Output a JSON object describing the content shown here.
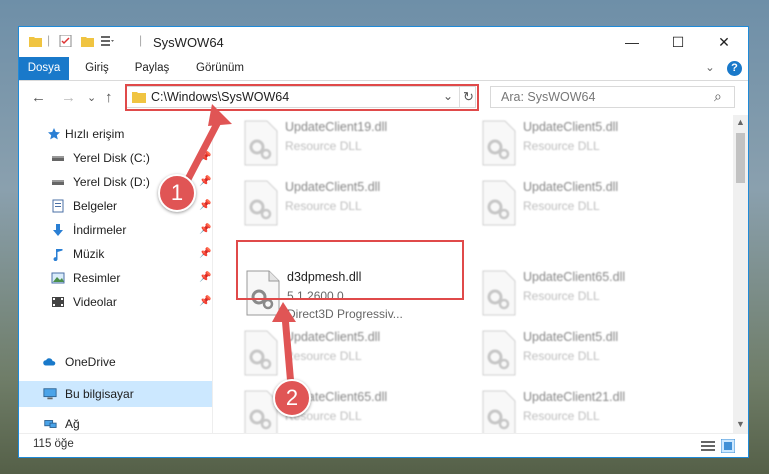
{
  "window": {
    "title": "SysWOW64",
    "minimize": "—",
    "maximize": "☐",
    "close": "✕"
  },
  "ribbon": {
    "tabs": [
      "Dosya",
      "Giriş",
      "Paylaş",
      "Görünüm"
    ],
    "collapse": "⌄",
    "help": "?"
  },
  "nav": {
    "back": "←",
    "forward": "→",
    "recent": "⌄",
    "up": "↑",
    "address": "C:\\Windows\\SysWOW64",
    "address_dropdown": "⌄",
    "refresh": "↻",
    "search_placeholder": "Ara: SysWOW64",
    "search_icon": "⌕"
  },
  "sidebar": {
    "items": [
      {
        "label": "Hızlı erişim",
        "icon": "star-icon"
      },
      {
        "label": "Yerel Disk (C:)",
        "icon": "drive-icon"
      },
      {
        "label": "Yerel Disk (D:)",
        "icon": "drive-icon"
      },
      {
        "label": "Belgeler",
        "icon": "documents-icon"
      },
      {
        "label": "İndirmeler",
        "icon": "download-icon"
      },
      {
        "label": "Müzik",
        "icon": "music-icon"
      },
      {
        "label": "Resimler",
        "icon": "pictures-icon"
      },
      {
        "label": "Videolar",
        "icon": "videos-icon"
      },
      {
        "label": "OneDrive",
        "icon": "cloud-icon"
      },
      {
        "label": "Bu bilgisayar",
        "icon": "computer-icon"
      },
      {
        "label": "Ağ",
        "icon": "network-icon"
      }
    ],
    "pin": "📌"
  },
  "files": [
    {
      "name": "UpdateClient19.dll",
      "type": "Resource DLL"
    },
    {
      "name": "UpdateClient5.dll",
      "type": "Resource DLL"
    },
    {
      "name": "UpdateClient5.dll",
      "type": "Resource DLL"
    },
    {
      "name": "UpdateClient5.dll",
      "type": "Resource DLL"
    },
    {
      "name": "d3dpmesh.dll",
      "version": "5.1.2600.0",
      "type": "Direct3D Progressiv..."
    },
    {
      "name": "UpdateClient65.dll",
      "type": "Resource DLL"
    },
    {
      "name": "UpdateClient5.dll",
      "type": "Resource DLL"
    },
    {
      "name": "UpdateClient5.dll",
      "type": "Resource DLL"
    },
    {
      "name": "UpdateClient65.dll",
      "type": "Resource DLL"
    },
    {
      "name": "UpdateClient21.dll",
      "type": "Resource DLL"
    }
  ],
  "status": {
    "count": "115 öğe"
  },
  "annotations": {
    "step1": "1",
    "step2": "2"
  },
  "colors": {
    "accent": "#1979ca",
    "highlight": "#e04a4a",
    "selected_nav": "#cce8ff"
  }
}
